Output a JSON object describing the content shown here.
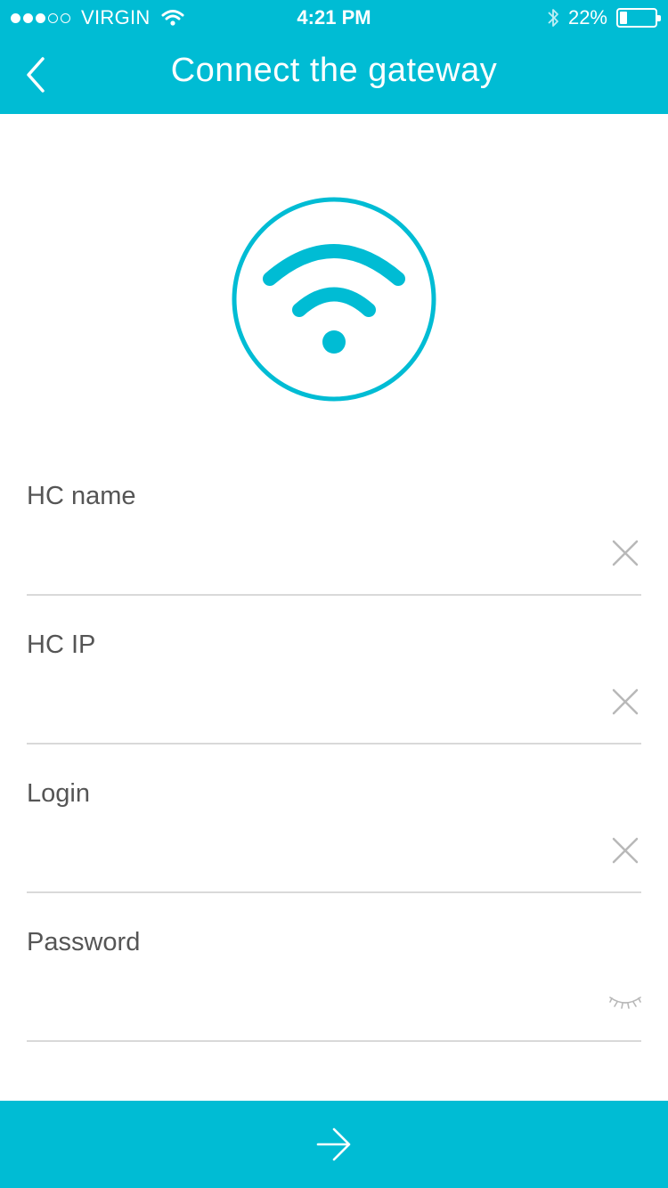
{
  "status_bar": {
    "carrier": "VIRGIN",
    "time": "4:21 PM",
    "battery_text": "22%",
    "battery_level": 0.22,
    "signal_bars_filled": 3,
    "signal_bars_total": 5
  },
  "nav": {
    "title": "Connect the gateway",
    "back_icon": "chevron-left-icon"
  },
  "emblem": {
    "icon": "wifi-icon"
  },
  "form": {
    "fields": [
      {
        "label": "HC name",
        "value": "",
        "action_icon": "clear-icon"
      },
      {
        "label": "HC IP",
        "value": "",
        "action_icon": "clear-icon"
      },
      {
        "label": "Login",
        "value": "",
        "action_icon": "clear-icon"
      },
      {
        "label": "Password",
        "value": "",
        "action_icon": "eye-closed-icon"
      }
    ]
  },
  "bottom_bar": {
    "icon": "arrow-right-icon"
  },
  "colors": {
    "accent": "#00BCD4",
    "label": "#555555",
    "divider": "#D9D9D9",
    "icon_gray": "#B8B8B8"
  }
}
